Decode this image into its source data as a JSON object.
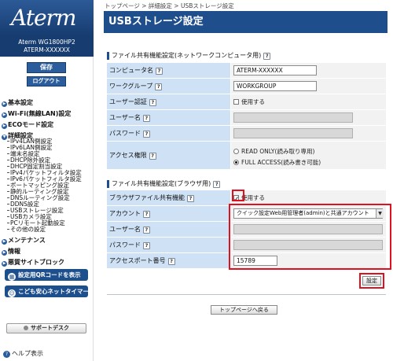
{
  "brand": {
    "logo": "Aterm",
    "model": "Aterm WG1800HP2",
    "ssid": "ATERM-XXXXXX"
  },
  "sidebar": {
    "save_label": "保存",
    "logout_label": "ログアウト",
    "menu": [
      {
        "label": "基本設定"
      },
      {
        "label": "Wi-Fi(無線LAN)設定"
      },
      {
        "label": "ECOモード設定"
      },
      {
        "label": "詳細設定"
      }
    ],
    "submenu": [
      "IPv4LAN側設定",
      "IPv6LAN側設定",
      "端末名設定",
      "DHCP除外設定",
      "DHCP固定割当設定",
      "IPv4パケットフィルタ設定",
      "IPv6パケットフィルタ設定",
      "ポートマッピング設定",
      "静的ルーティング設定",
      "DNSルーティング設定",
      "DDNS設定",
      "USBストレージ設定",
      "USBカメラ設定",
      "PCリモート起動設定",
      "その他の設定"
    ],
    "menu2": [
      {
        "label": "メンテナンス"
      },
      {
        "label": "情報"
      },
      {
        "label": "悪質サイトブロック"
      }
    ],
    "qr_button": "設定用QRコードを表示",
    "kids_button": "こども安心ネットタイマー",
    "support_button": "サポートデスク",
    "help_link": "ヘルプ表示"
  },
  "main": {
    "breadcrumb": "トップページ > 詳細設定 > USBストレージ設定",
    "title": "USBストレージ設定",
    "network_section": {
      "title": "ファイル共有機能設定(ネットワークコンピュータ用)",
      "computer_name_label": "コンピュータ名",
      "computer_name_value": "ATERM-XXXXXX",
      "workgroup_label": "ワークグループ",
      "workgroup_value": "WORKGROUP",
      "auth_label": "ユーザー認証",
      "auth_checkbox": "使用する",
      "username_label": "ユーザー名",
      "password_label": "パスワード",
      "access_label": "アクセス権限",
      "access_option_ro": "READ ONLY(読み取り専用)",
      "access_option_full": "FULL ACCESS(読み書き可能)"
    },
    "browser_section": {
      "title": "ファイル共有機能設定(ブラウザ用)",
      "enable_label": "ブラウザファイル共有機能",
      "enable_checkbox": "使用する",
      "account_label": "アカウント",
      "account_value": "クイック設定Web用管理者(admin)と共通アカウント",
      "username_label": "ユーザー名",
      "password_label": "パスワード",
      "port_label": "アクセスポート番号",
      "port_value": "15789"
    },
    "settings_button": "設定",
    "back_button": "トップページへ戻る"
  },
  "colors": {
    "accent": "#1f4e8c",
    "label_bg": "#cfe2f5",
    "highlight": "#e0101e"
  }
}
